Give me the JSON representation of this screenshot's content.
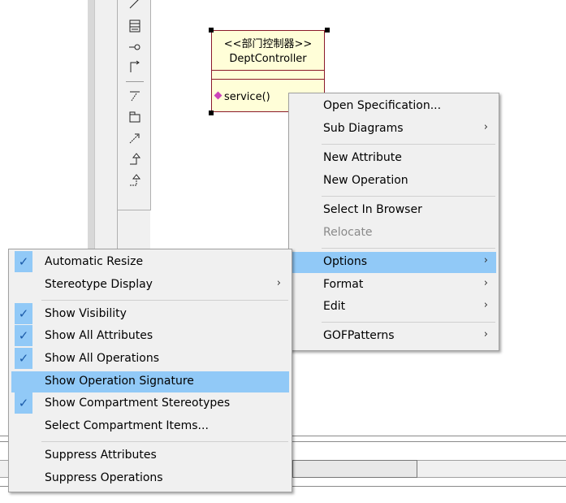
{
  "uml_class": {
    "stereotype": "<<部门控制器>>",
    "name": "DeptController",
    "operation": "service()"
  },
  "context_menu": {
    "items": [
      {
        "label": "Open Specification...",
        "submenu": false
      },
      {
        "label": "Sub Diagrams",
        "submenu": true
      },
      {
        "label": "New Attribute",
        "submenu": false
      },
      {
        "label": "New Operation",
        "submenu": false
      },
      {
        "label": "Select In Browser",
        "submenu": false
      },
      {
        "label": "Relocate",
        "submenu": false,
        "disabled": true
      },
      {
        "label": "Options",
        "submenu": true,
        "highlighted": true
      },
      {
        "label": "Format",
        "submenu": true
      },
      {
        "label": "Edit",
        "submenu": true
      },
      {
        "label": "GOFPatterns",
        "submenu": true
      }
    ]
  },
  "options_submenu": {
    "items": [
      {
        "label": "Automatic Resize",
        "checked": true
      },
      {
        "label": "Stereotype Display",
        "submenu": true
      },
      {
        "label": "Show Visibility",
        "checked": true
      },
      {
        "label": "Show All Attributes",
        "checked": true
      },
      {
        "label": "Show All Operations",
        "checked": true
      },
      {
        "label": "Show Operation Signature",
        "highlighted": true
      },
      {
        "label": "Show Compartment Stereotypes",
        "checked": true
      },
      {
        "label": "Select Compartment Items..."
      },
      {
        "label": "Suppress Attributes"
      },
      {
        "label": "Suppress Operations"
      }
    ]
  },
  "glyphs": {
    "check": "✓",
    "arrow": "›"
  },
  "colors": {
    "highlight": "#91c9f7",
    "uml_fill": "#fffed8",
    "uml_border": "#8b1a2a",
    "menu_bg": "#f0f0f0"
  }
}
